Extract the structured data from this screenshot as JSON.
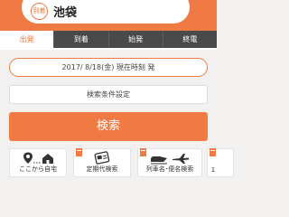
{
  "header": {
    "badge_label": "到着",
    "station_name": "池袋"
  },
  "tabs": [
    {
      "label": "出発",
      "active": true
    },
    {
      "label": "到着",
      "active": false
    },
    {
      "label": "始発",
      "active": false
    },
    {
      "label": "終電",
      "active": false
    }
  ],
  "datetime": {
    "value": "2017/ 8/18(金) 現在時刻 発"
  },
  "conditions": {
    "label": "検索条件設定"
  },
  "search": {
    "label": "検索"
  },
  "quick_links": [
    {
      "label": "ここから自宅",
      "icon": "location-home-icon"
    },
    {
      "label": "定期代検索",
      "icon": "commuter-pass-icon"
    },
    {
      "label": "列車名･便名検索",
      "icon": "train-plane-icon"
    },
    {
      "label": "1",
      "icon": ""
    }
  ],
  "colors": {
    "accent": "#f07a43",
    "tab_bar": "#4a4a4a",
    "background": "#f2f1ef"
  }
}
